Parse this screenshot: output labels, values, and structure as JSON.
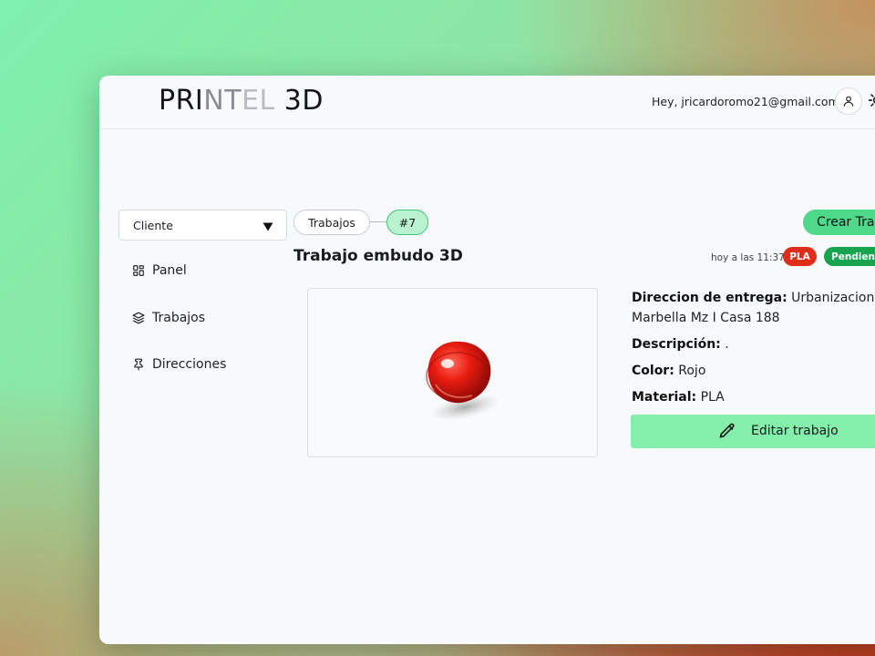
{
  "app": {
    "logo_parts": [
      "PRI",
      "NT",
      "EL",
      " 3D"
    ]
  },
  "header": {
    "greeting": "Hey, jricardoromo21@gmail.com!",
    "user_icon": "user-icon",
    "theme_icon": "sun-icon"
  },
  "sidebar": {
    "role_select": {
      "value": "Cliente"
    },
    "items": [
      {
        "label": "Panel",
        "icon": "grid-icon"
      },
      {
        "label": "Trabajos",
        "icon": "layers-icon"
      },
      {
        "label": "Direcciones",
        "icon": "pin-icon"
      }
    ]
  },
  "breadcrumb": {
    "items": [
      "Trabajos",
      "#7"
    ]
  },
  "actions": {
    "create_label": "Crear Tra"
  },
  "job": {
    "title": "Trabajo embudo 3D",
    "timestamp": "hoy a las 11:37",
    "material_badge": "PLA",
    "status_badge": "Pendient",
    "address_label": "Direccion de entrega:",
    "address_line1": "Urbanizacion Vil",
    "address_line2": "Marbella Mz I Casa 188",
    "description_label": "Descripción:",
    "description_value": ".",
    "color_label": "Color:",
    "color_value": "Rojo",
    "material_label": "Material:",
    "material_value": "PLA",
    "edit_label": "Editar trabajo"
  },
  "colors": {
    "accent_green": "#4ed88a",
    "badge_red": "#e02d1a",
    "badge_green": "#17a44f",
    "edit_button": "#84eeab"
  }
}
